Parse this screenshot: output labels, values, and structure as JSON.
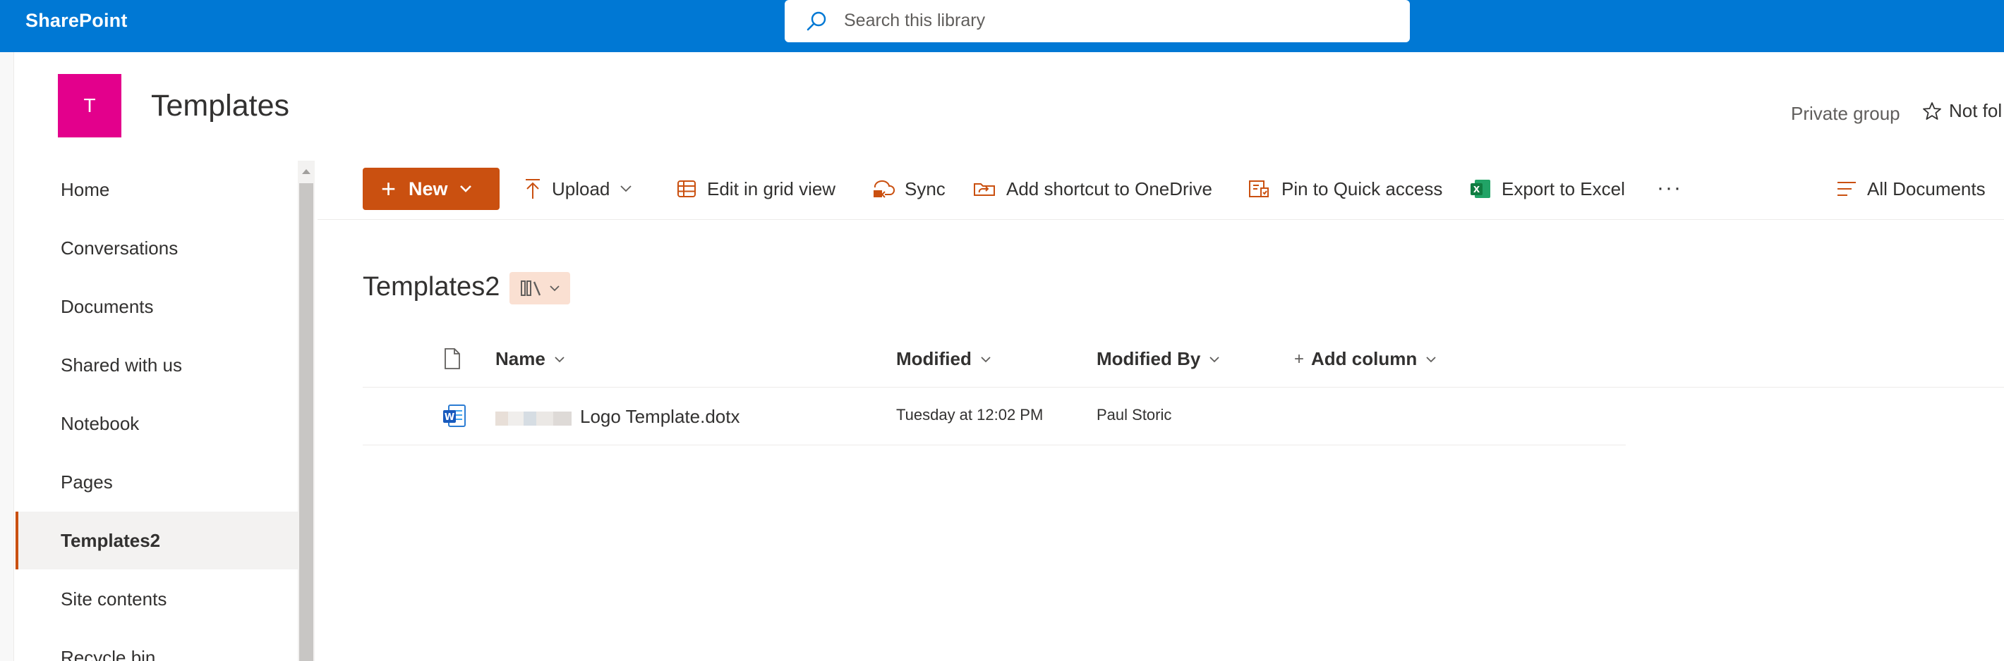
{
  "suite": {
    "brand": "SharePoint",
    "search_placeholder": "Search this library"
  },
  "site": {
    "logo_letter": "T",
    "title": "Templates",
    "privacy": "Private group",
    "follow_label": "Not fol",
    "logo_color": "#e3008c"
  },
  "nav": {
    "items": [
      {
        "label": "Home"
      },
      {
        "label": "Conversations"
      },
      {
        "label": "Documents"
      },
      {
        "label": "Shared with us"
      },
      {
        "label": "Notebook"
      },
      {
        "label": "Pages"
      },
      {
        "label": "Templates2",
        "selected": true
      },
      {
        "label": "Site contents"
      },
      {
        "label": "Recycle bin"
      }
    ]
  },
  "commands": {
    "new_label": "New",
    "upload_label": "Upload",
    "grid_label": "Edit in grid view",
    "sync_label": "Sync",
    "shortcut_label": "Add shortcut to OneDrive",
    "pin_label": "Pin to Quick access",
    "export_label": "Export to Excel",
    "more_label": "···",
    "view_label": "All Documents",
    "accent_color": "#ca5010"
  },
  "library": {
    "title": "Templates2"
  },
  "table": {
    "columns": {
      "name": "Name",
      "modified": "Modified",
      "modified_by": "Modified By",
      "add_column": "Add column"
    },
    "rows": [
      {
        "name": "Logo Template.dotx",
        "modified": "Tuesday at 12:02 PM",
        "modified_by": "Paul Storic",
        "icon": "word-icon"
      }
    ]
  }
}
